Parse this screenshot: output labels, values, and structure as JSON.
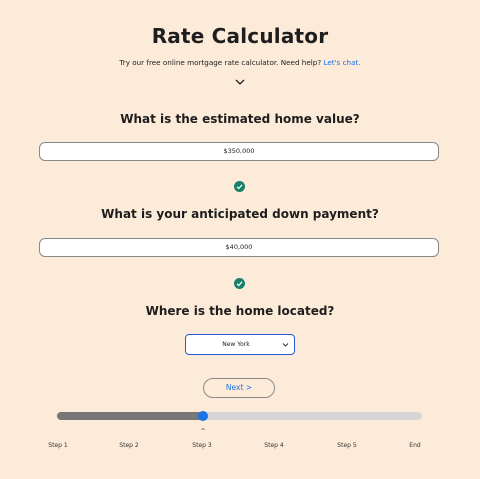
{
  "header": {
    "title": "Rate Calculator",
    "subtitle_text": "Try our free online mortgage rate calculator. Need help?",
    "subtitle_link": "Let's chat."
  },
  "questions": [
    {
      "label": "What is the estimated home value?",
      "value": "$350,000"
    },
    {
      "label": "What is your anticipated down payment?",
      "value": "$40,000"
    },
    {
      "label": "Where is the home located?",
      "value": "New York"
    }
  ],
  "next_button": "Next >",
  "progress": {
    "current_step": 3,
    "fraction": 0.4,
    "steps": [
      "Step 1",
      "Step 2",
      "Step 3",
      "Step 4",
      "Step 5",
      "End"
    ]
  },
  "colors": {
    "background": "#fcebd9",
    "accent": "#1a73e8",
    "check": "#16806a"
  },
  "icons": [
    "chevron-down-icon",
    "check-circle-icon",
    "select-arrow-icon",
    "caret-up-icon"
  ]
}
